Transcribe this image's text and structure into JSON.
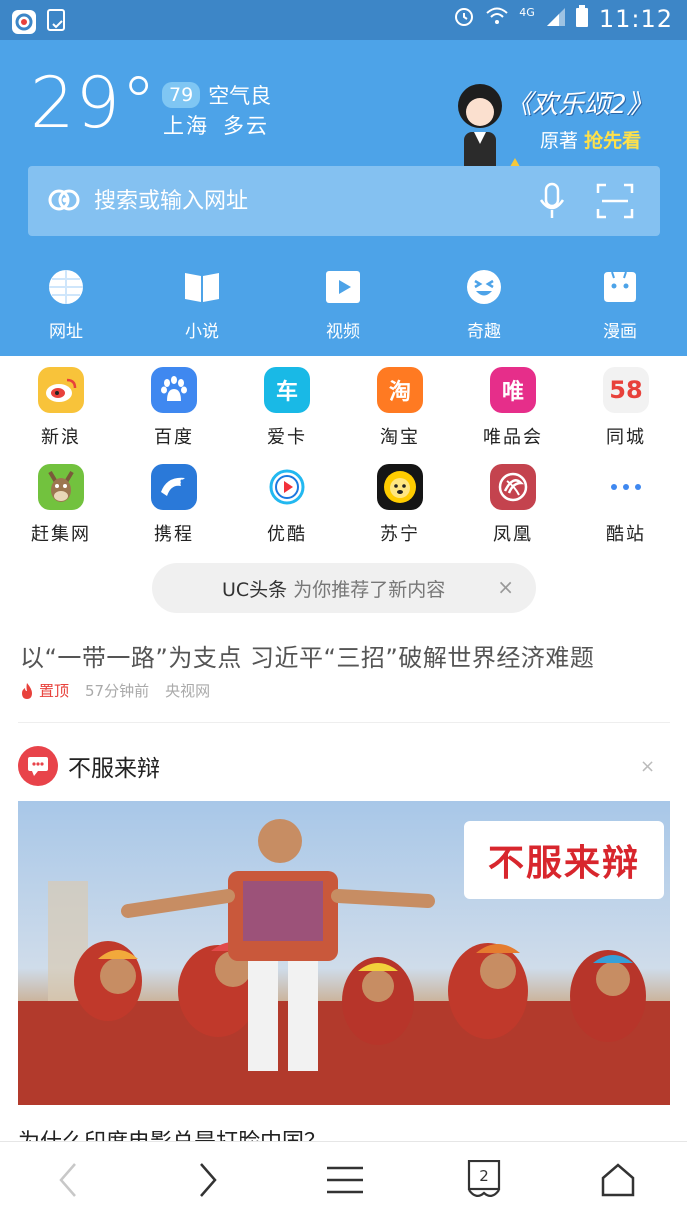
{
  "status_bar": {
    "time": "11:12",
    "network": "4G"
  },
  "weather": {
    "temperature": "29°",
    "aqi_value": "79",
    "aqi_text": "空气良",
    "city": "上海",
    "condition": "多云"
  },
  "promo": {
    "title": "《欢乐颂2》",
    "sub_prefix": "原著",
    "sub_highlight": "抢先看"
  },
  "search": {
    "placeholder": "搜索或输入网址"
  },
  "quick_nav": [
    {
      "label": "网址",
      "icon": "globe-icon"
    },
    {
      "label": "小说",
      "icon": "book-icon"
    },
    {
      "label": "视频",
      "icon": "play-icon"
    },
    {
      "label": "奇趣",
      "icon": "laugh-face-icon"
    },
    {
      "label": "漫画",
      "icon": "comic-face-icon"
    }
  ],
  "sites": [
    {
      "label": "新浪",
      "glyph": "",
      "color": "#f8c33a",
      "icon": "sina-weibo-icon"
    },
    {
      "label": "百度",
      "glyph": "",
      "color": "#3f88f0",
      "icon": "baidu-paw-icon"
    },
    {
      "label": "爱卡",
      "glyph": "车",
      "color": "#19b9e6",
      "icon": "aika-car-icon"
    },
    {
      "label": "淘宝",
      "glyph": "淘",
      "color": "#ff7a22",
      "icon": "taobao-icon"
    },
    {
      "label": "唯品会",
      "glyph": "唯",
      "color": "#e62e8a",
      "icon": "vip-icon"
    },
    {
      "label": "同城",
      "glyph": "58",
      "color": "#f2f2f2",
      "icon": "58-tongcheng-icon"
    },
    {
      "label": "赶集网",
      "glyph": "",
      "color": "#72c23e",
      "icon": "ganji-donkey-icon"
    },
    {
      "label": "携程",
      "glyph": "",
      "color": "#2a79d9",
      "icon": "ctrip-dolphin-icon"
    },
    {
      "label": "优酷",
      "glyph": "",
      "color": "#ffffff",
      "icon": "youku-play-icon"
    },
    {
      "label": "苏宁",
      "glyph": "",
      "color": "#151515",
      "icon": "suning-lion-icon"
    },
    {
      "label": "凤凰",
      "glyph": "",
      "color": "#c4434e",
      "icon": "ifeng-phoenix-icon"
    },
    {
      "label": "酷站",
      "glyph": "",
      "color": "#ffffff",
      "icon": "more-dots-icon"
    }
  ],
  "uc_news": {
    "title": "UC头条",
    "text": "为你推荐了新内容"
  },
  "headline": {
    "title": "以“一带一路”为支点 习近平“三招”破解世界经济难题",
    "pin_label": "置顶",
    "time": "57分钟前",
    "source": "央视网"
  },
  "card": {
    "title": "不服来辩",
    "image_badge": "不服来辩",
    "caption": "为什么印度电影总是打脸中国？"
  },
  "bottom_nav": {
    "tabs_count": "2"
  }
}
